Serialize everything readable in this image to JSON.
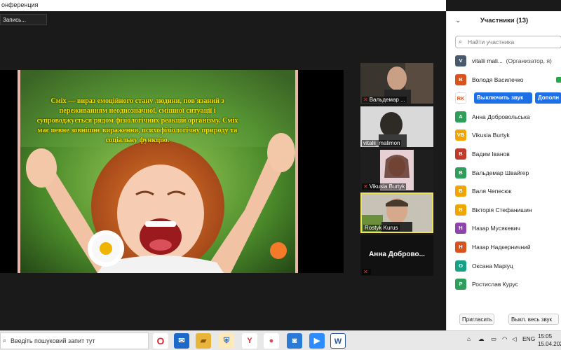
{
  "window": {
    "title": "онференция"
  },
  "recording": {
    "label": "Запись..."
  },
  "slide": {
    "text": "Сміх — вираз емоційного стану людини, пов'язаний з переживанням неоднозначної, смішної ситуації і супроводжується рядом фізіологічних реакцій організму. Сміх має певне зовнішнє вираження, психофізіологічну природу та соціальну функцію.",
    "accent": "#f2e400"
  },
  "videos": [
    {
      "name": "Вальдемар ...",
      "muted": true
    },
    {
      "name": "vitalii_malimon",
      "muted": false
    },
    {
      "name": "Vikusia Burtyk",
      "muted": true
    },
    {
      "name": "Rostyk Kurus",
      "muted": false,
      "active": true
    },
    {
      "name": "Анна Доброво...",
      "muted": true,
      "camera_off": true
    }
  ],
  "panel": {
    "title": "Участники (13)",
    "search_placeholder": "Найти участника",
    "participants": [
      {
        "initials": "V",
        "color": "#4a5a6e",
        "name": "vitalii mali...",
        "role": "(Организатор, я)"
      },
      {
        "initials": "В",
        "color": "#d9531e",
        "name": "Володя Василечко",
        "role": ""
      },
      {
        "initials": "RK",
        "color": "#ffffff",
        "name": "",
        "role": "",
        "actions": [
          "Выключить звук",
          "Дополн"
        ]
      },
      {
        "initials": "А",
        "color": "#2e9e5b",
        "name": "Анна Добровольська",
        "role": ""
      },
      {
        "initials": "VB",
        "color": "#f0a500",
        "name": "Vikusia Burtyk",
        "role": ""
      },
      {
        "initials": "В",
        "color": "#c0392b",
        "name": "Вадим Іванов",
        "role": ""
      },
      {
        "initials": "В",
        "color": "#2e9e5b",
        "name": "Вальдемар Швайгер",
        "role": ""
      },
      {
        "initials": "В",
        "color": "#f0a500",
        "name": "Валя Чепесюк",
        "role": ""
      },
      {
        "initials": "В",
        "color": "#f0a500",
        "name": "Вікторія Стефанишин",
        "role": ""
      },
      {
        "initials": "Н",
        "color": "#8e44ad",
        "name": "Назар Мусякевич",
        "role": ""
      },
      {
        "initials": "Н",
        "color": "#d9531e",
        "name": "Назар Надкерничний",
        "role": ""
      },
      {
        "initials": "О",
        "color": "#16a085",
        "name": "Оксана Маріуц",
        "role": ""
      },
      {
        "initials": "Р",
        "color": "#2e9e5b",
        "name": "Ростислав Курус",
        "role": ""
      }
    ],
    "invite_label": "Пригласить",
    "mute_all_label": "Выкл. весь звук"
  },
  "taskbar": {
    "search_placeholder": "Введіть пошуковий запит тут",
    "apps": [
      {
        "icon": "opera-icon",
        "glyph": "O",
        "color": "#e0262f"
      },
      {
        "icon": "mail-icon",
        "glyph": "✉",
        "color": "#1b6ac9"
      },
      {
        "icon": "folder-icon",
        "glyph": "▰",
        "color": "#e8b43a"
      },
      {
        "icon": "shield-icon",
        "glyph": "⛨",
        "color": "#2467c8"
      },
      {
        "icon": "yandex-icon",
        "glyph": "Y",
        "color": "#ffffff"
      },
      {
        "icon": "chat-icon",
        "glyph": "●",
        "color": "#d9474f"
      },
      {
        "icon": "photos-icon",
        "glyph": "◙",
        "color": "#2b7bd6"
      },
      {
        "icon": "zoom-icon",
        "glyph": "▶",
        "color": "#2d8cff"
      },
      {
        "icon": "word-icon",
        "glyph": "W",
        "color": "#2b579a"
      }
    ],
    "lang": "ENG",
    "time": "15:05",
    "date": "15.04.202"
  }
}
